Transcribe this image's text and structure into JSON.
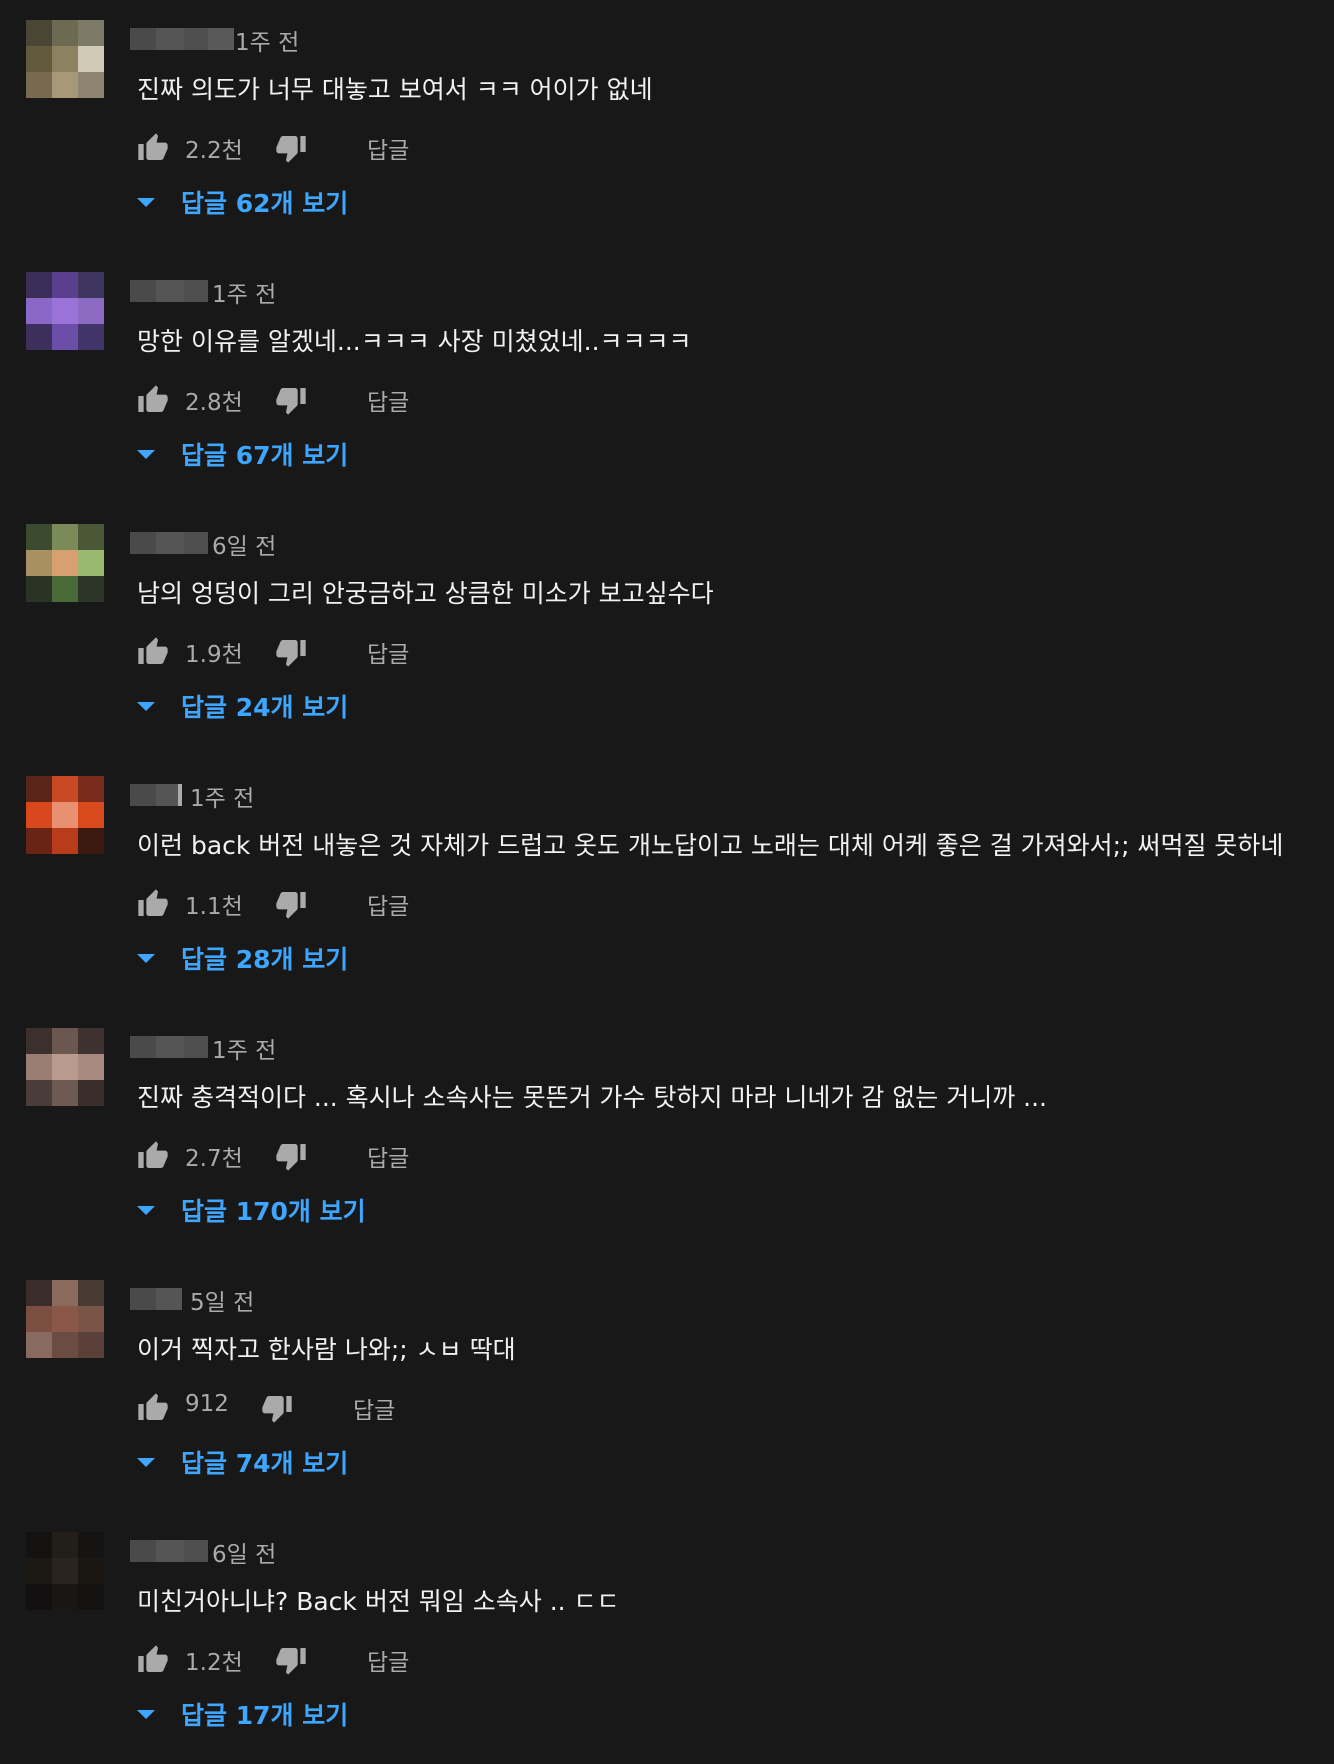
{
  "colors": {
    "background": "#181818",
    "text_primary": "#f1f1f1",
    "text_secondary": "#aaaaaa",
    "link_blue": "#3ea6ff"
  },
  "comments": [
    {
      "time": "1주 전",
      "text": "진짜 의도가 너무 대놓고 보여서 ㅋㅋ 어이가 없네",
      "likes": "2.2천",
      "reply_label": "답글",
      "view_replies": "답글 62개 보기"
    },
    {
      "time": "1주 전",
      "text": "망한 이유를 알겠네...ㅋㅋㅋ 사장 미쳤었네..ㅋㅋㅋㅋ",
      "likes": "2.8천",
      "reply_label": "답글",
      "view_replies": "답글 67개 보기"
    },
    {
      "time": "6일 전",
      "text": "남의 엉덩이 그리 안궁금하고 상큼한 미소가 보고싶수다",
      "likes": "1.9천",
      "reply_label": "답글",
      "view_replies": "답글 24개 보기"
    },
    {
      "time": "1주 전",
      "text": "이런 back 버전 내놓은 것 자체가 드럽고 옷도 개노답이고 노래는 대체 어케 좋은 걸 가져와서;; 써먹질 못하네",
      "likes": "1.1천",
      "reply_label": "답글",
      "view_replies": "답글 28개 보기"
    },
    {
      "time": "1주 전",
      "text": "진짜 충격적이다 ... 혹시나 소속사는 못뜬거 가수 탓하지 마라 니네가 감 없는 거니까 ...",
      "likes": "2.7천",
      "reply_label": "답글",
      "view_replies": "답글 170개 보기"
    },
    {
      "time": "5일 전",
      "text": "이거 찍자고 한사람 나와;; ㅅㅂ 딱대",
      "likes": "912",
      "reply_label": "답글",
      "view_replies": "답글 74개 보기"
    },
    {
      "time": "6일 전",
      "text": "미친거아니냐? Back 버전 뭐임 소속사 .. ㄷㄷ",
      "likes": "1.2천",
      "reply_label": "답글",
      "view_replies": "답글 17개 보기"
    }
  ]
}
